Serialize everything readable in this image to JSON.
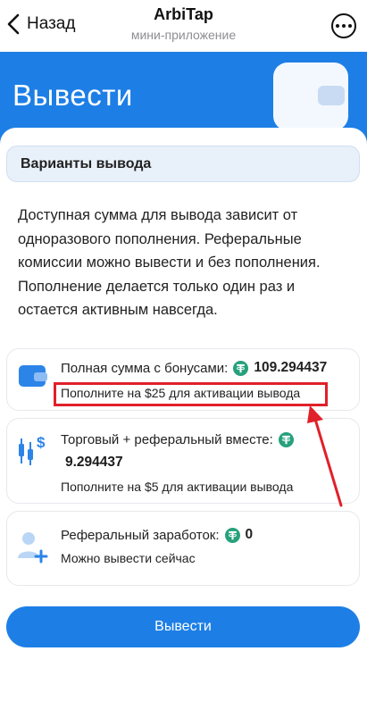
{
  "topbar": {
    "back_label": "Назад",
    "title": "ArbiTap",
    "subtitle": "мини-приложение"
  },
  "hero": {
    "title": "Вывести"
  },
  "section": {
    "title": "Варианты вывода",
    "description": "Доступная сумма для вывода зависит от одноразового пополнения. Реферальные комиссии можно вывести и без пополнения. Пополнение делается только один раз и остается активным навсегда."
  },
  "options": [
    {
      "label": "Полная сумма с бонусами:",
      "amount": "109.294437",
      "hint": "Пополните на $25 для активации вывода",
      "icon": "wallet-icon"
    },
    {
      "label": "Торговый + реферальный вместе:",
      "amount": "9.294437",
      "hint": "Пополните на $5 для активации вывода",
      "icon": "trading-chart-icon"
    },
    {
      "label": "Реферальный заработок:",
      "amount": "0",
      "hint": "Можно вывести сейчас",
      "icon": "add-user-icon"
    }
  ],
  "withdraw_button": {
    "label": "Вывести"
  },
  "colors": {
    "accent": "#1d7fe6",
    "tether": "#26a17b",
    "annotation": "#e0202a"
  }
}
